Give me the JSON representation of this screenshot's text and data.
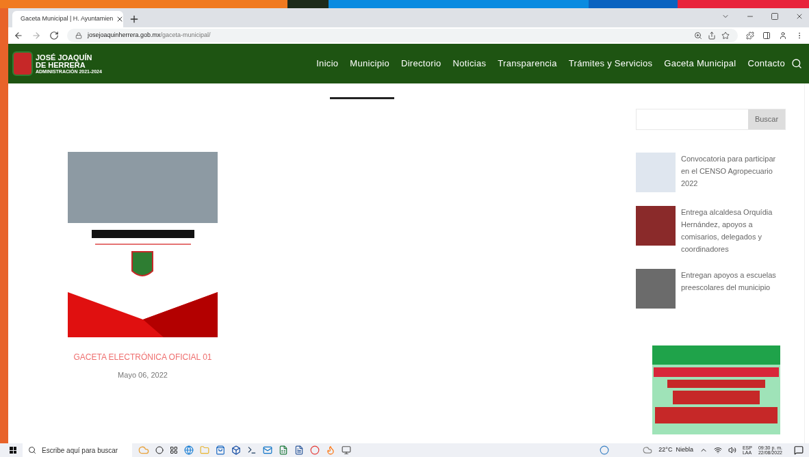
{
  "browser": {
    "tab_title": "Gaceta Municipal | H. Ayuntamien",
    "url_host": "josejoaquinherrera.gob.mx",
    "url_path": "/gaceta-municipal/"
  },
  "site": {
    "logo_lines": [
      "JOSÉ JOAQUÍN",
      "DE HERRERA",
      "ADMINISTRACIÓN 2021-2024"
    ],
    "nav": [
      "Inicio",
      "Municipio",
      "Directorio",
      "Noticias",
      "Transparencia",
      "Trámites y Servicios",
      "Gaceta Municipal",
      "Contacto"
    ]
  },
  "posts": [
    {
      "title": "GACETA ELECTRÓNICA OFICIAL 01",
      "date": "Mayo 06, 2022"
    }
  ],
  "sidebar": {
    "search_button": "Buscar",
    "recent": [
      {
        "title": "Convocatoria para participar en el CENSO Agropecuario 2022"
      },
      {
        "title": "Entrega alcaldesa Orquídia Hernández, apoyos a comisarios, delegados y coordinadores"
      },
      {
        "title": "Entregan apoyos a escuelas preescolares del municipio"
      }
    ]
  },
  "taskbar": {
    "search_placeholder": "Escribe aquí para buscar",
    "weather": "22°C  Niebla",
    "lang": "ESP",
    "layout": "LAA",
    "time": "09:30 p. m.",
    "date": "22/08/2022"
  }
}
